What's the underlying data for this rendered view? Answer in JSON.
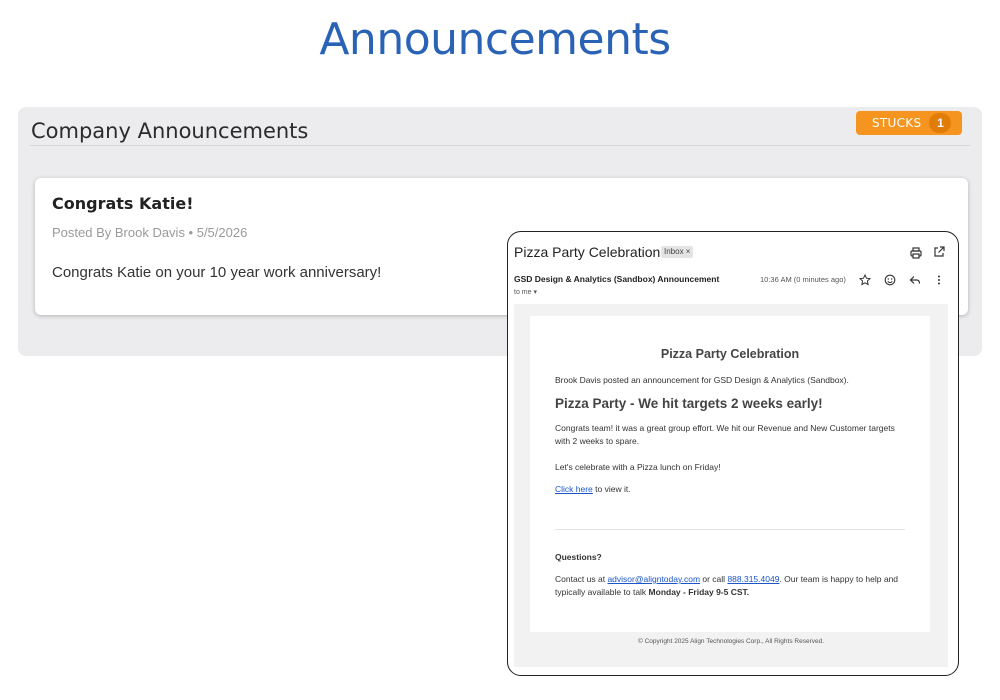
{
  "page": {
    "title": "Announcements"
  },
  "panel": {
    "title": "Company Announcements",
    "stucks": {
      "label": "STUCKS",
      "count": "1",
      "color": "#f5951f"
    }
  },
  "announcement": {
    "title": "Congrats Katie!",
    "meta": "Posted By Brook Davis • 5/5/2026",
    "body": "Congrats Katie on your 10 year work anniversary!"
  },
  "email": {
    "subject": "Pizza Party Celebration",
    "label": "Inbox ×",
    "sender": "GSD Design & Analytics (Sandbox) Announcement",
    "recipient": "to me ▾",
    "time": "10:36 AM (0 minutes ago)",
    "icons": [
      "print-icon",
      "open-in-new-icon",
      "star-icon",
      "smile-icon",
      "reply-icon",
      "more-vert-icon"
    ],
    "content": {
      "heading": "Pizza Party Celebration",
      "posted": "Brook Davis posted an announcement for GSD Design & Analytics (Sandbox).",
      "title": "Pizza Party - We hit targets 2 weeks early!",
      "para1": "Congrats team!  it was a great group effort.  We hit our Revenue and New Customer targets with 2 weeks to spare.",
      "para2": "Let's celebrate with a Pizza lunch on Friday!",
      "click_link": "Click here",
      "click_suffix": " to view it.",
      "questions": "Questions?",
      "contact_prefix": "Contact us at ",
      "contact_email": "advisor@aligntoday.com",
      "contact_mid": " or call ",
      "contact_phone": "888.315.4049",
      "contact_suffix": ". Our team is happy to help and typically available to talk ",
      "contact_hours": "Monday - Friday 9-5 CST.",
      "copyright": "© Copyright 2025 Align Technologies Corp., All Rights Reserved."
    }
  }
}
